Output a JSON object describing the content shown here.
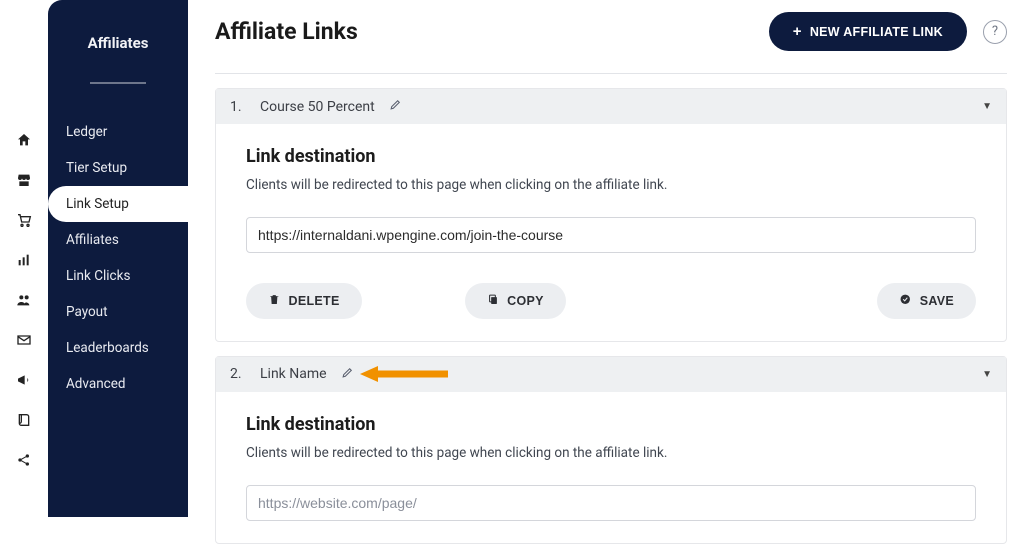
{
  "rail": {
    "icons": [
      {
        "name": "home-icon"
      },
      {
        "name": "store-icon"
      },
      {
        "name": "cart-icon"
      },
      {
        "name": "bars-icon"
      },
      {
        "name": "users-icon"
      },
      {
        "name": "mail-icon"
      },
      {
        "name": "megaphone-icon"
      },
      {
        "name": "book-icon"
      },
      {
        "name": "share-icon"
      }
    ]
  },
  "sidebar": {
    "title": "Affiliates",
    "items": [
      {
        "label": "Ledger",
        "active": false
      },
      {
        "label": "Tier Setup",
        "active": false
      },
      {
        "label": "Link Setup",
        "active": true
      },
      {
        "label": "Affiliates",
        "active": false
      },
      {
        "label": "Link Clicks",
        "active": false
      },
      {
        "label": "Payout",
        "active": false
      },
      {
        "label": "Leaderboards",
        "active": false
      },
      {
        "label": "Advanced",
        "active": false
      }
    ]
  },
  "header": {
    "title": "Affiliate Links",
    "new_btn": "NEW AFFILIATE LINK",
    "help": "?"
  },
  "panels": [
    {
      "number": "1.",
      "title": "Course 50 Percent",
      "section_title": "Link destination",
      "section_desc": "Clients will be redirected to this page when clicking on the affiliate link.",
      "url_value": "https://internaldani.wpengine.com/join-the-course",
      "url_placeholder": "",
      "delete_label": "DELETE",
      "copy_label": "COPY",
      "save_label": "SAVE"
    },
    {
      "number": "2.",
      "title": "Link Name",
      "section_title": "Link destination",
      "section_desc": "Clients will be redirected to this page when clicking on the affiliate link.",
      "url_value": "",
      "url_placeholder": "https://website.com/page/"
    }
  ]
}
